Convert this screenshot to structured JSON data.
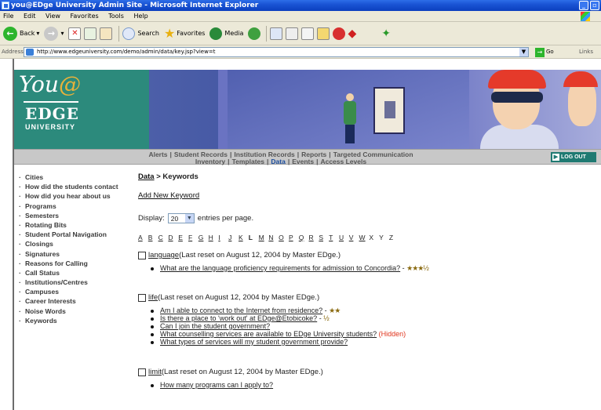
{
  "window": {
    "title": "you@EDge University Admin Site - Microsoft Internet Explorer",
    "min": "_",
    "max": "▫",
    "close": "✕"
  },
  "menu": [
    "File",
    "Edit",
    "View",
    "Favorites",
    "Tools",
    "Help"
  ],
  "toolbar": {
    "back": "Back",
    "search": "Search",
    "favorites": "Favorites",
    "media": "Media"
  },
  "address": {
    "label": "Address",
    "url": "http://www.edgeuniversity.com/demo/admin/data/key.jsp?view=t",
    "go": "Go",
    "links": "Links"
  },
  "logo": {
    "you": "You",
    "at": "@",
    "edge": "EDGE",
    "university": "UNIVERSITY"
  },
  "nav": {
    "line1": [
      "Alerts",
      "Student Records",
      "Institution Records",
      "Reports",
      "Targeted Communication"
    ],
    "line2": [
      "Inventory",
      "Templates",
      "Data",
      "Events",
      "Access Levels"
    ],
    "active": "Data",
    "logout": "LOG OUT"
  },
  "sidebar": [
    "Cities",
    "How did the students contact",
    "How did you hear about us",
    "Programs",
    "Semesters",
    "Rotating Bits",
    "Student Portal Navigation",
    "Closings",
    "Signatures",
    "Reasons for Calling",
    "Call Status",
    "Institutions/Centres",
    "Campuses",
    "Career Interests",
    "Noise Words",
    "Keywords"
  ],
  "main": {
    "crumb_link": "Data",
    "crumb_sep": " > ",
    "crumb_current": "Keywords",
    "add_link": "Add New Keyword",
    "display_label": "Display:",
    "display_value": "20",
    "display_suffix": "entries per page.",
    "alphabet": [
      "A",
      "B",
      "C",
      "D",
      "E",
      "F",
      "G",
      "H",
      "I",
      "J",
      "K",
      "L",
      "M",
      "N",
      "O",
      "P",
      "Q",
      "R",
      "S",
      "T",
      "U",
      "V",
      "W",
      "X",
      "Y",
      "Z"
    ],
    "alpha_plain": [
      "L",
      "X",
      "Y",
      "Z"
    ],
    "alpha_current": "L",
    "groups": [
      {
        "keyword": "language",
        "note": " (Last reset on August 12, 2004 by Master EDge.)",
        "items": [
          {
            "q": "What are the language proficiency requirements for admission to Concordia?",
            "suffix": " - ",
            "stars": "★★★½",
            "hidden": ""
          }
        ]
      },
      {
        "keyword": "life",
        "note": " (Last reset on August 12, 2004 by Master EDge.)",
        "items": [
          {
            "q": "Am I able to connect to the Internet from residence?",
            "suffix": " - ",
            "stars": "★★",
            "hidden": ""
          },
          {
            "q": "Is there a place to 'work out' at EDge@Etobicoke?",
            "suffix": " - ",
            "stars": "½",
            "hidden": ""
          },
          {
            "q": "Can I join the student government?",
            "suffix": "",
            "stars": "",
            "hidden": ""
          },
          {
            "q": "What counselling services are available to EDge University students?",
            "suffix": " ",
            "stars": "",
            "hidden": "(Hidden)"
          },
          {
            "q": "What types of services will my student government provide?",
            "suffix": "",
            "stars": "",
            "hidden": ""
          }
        ]
      },
      {
        "keyword": "limit",
        "note": " (Last reset on August 12, 2004 by Master EDge.)",
        "items": [
          {
            "q": "How many programs can I apply to?",
            "suffix": "",
            "stars": "",
            "hidden": ""
          }
        ]
      }
    ]
  },
  "colors": {
    "titlebar": "#1a54d4",
    "banner_green": "#2c8a7c",
    "nav_active": "#1d4e9e",
    "hidden": "#e0341c"
  }
}
